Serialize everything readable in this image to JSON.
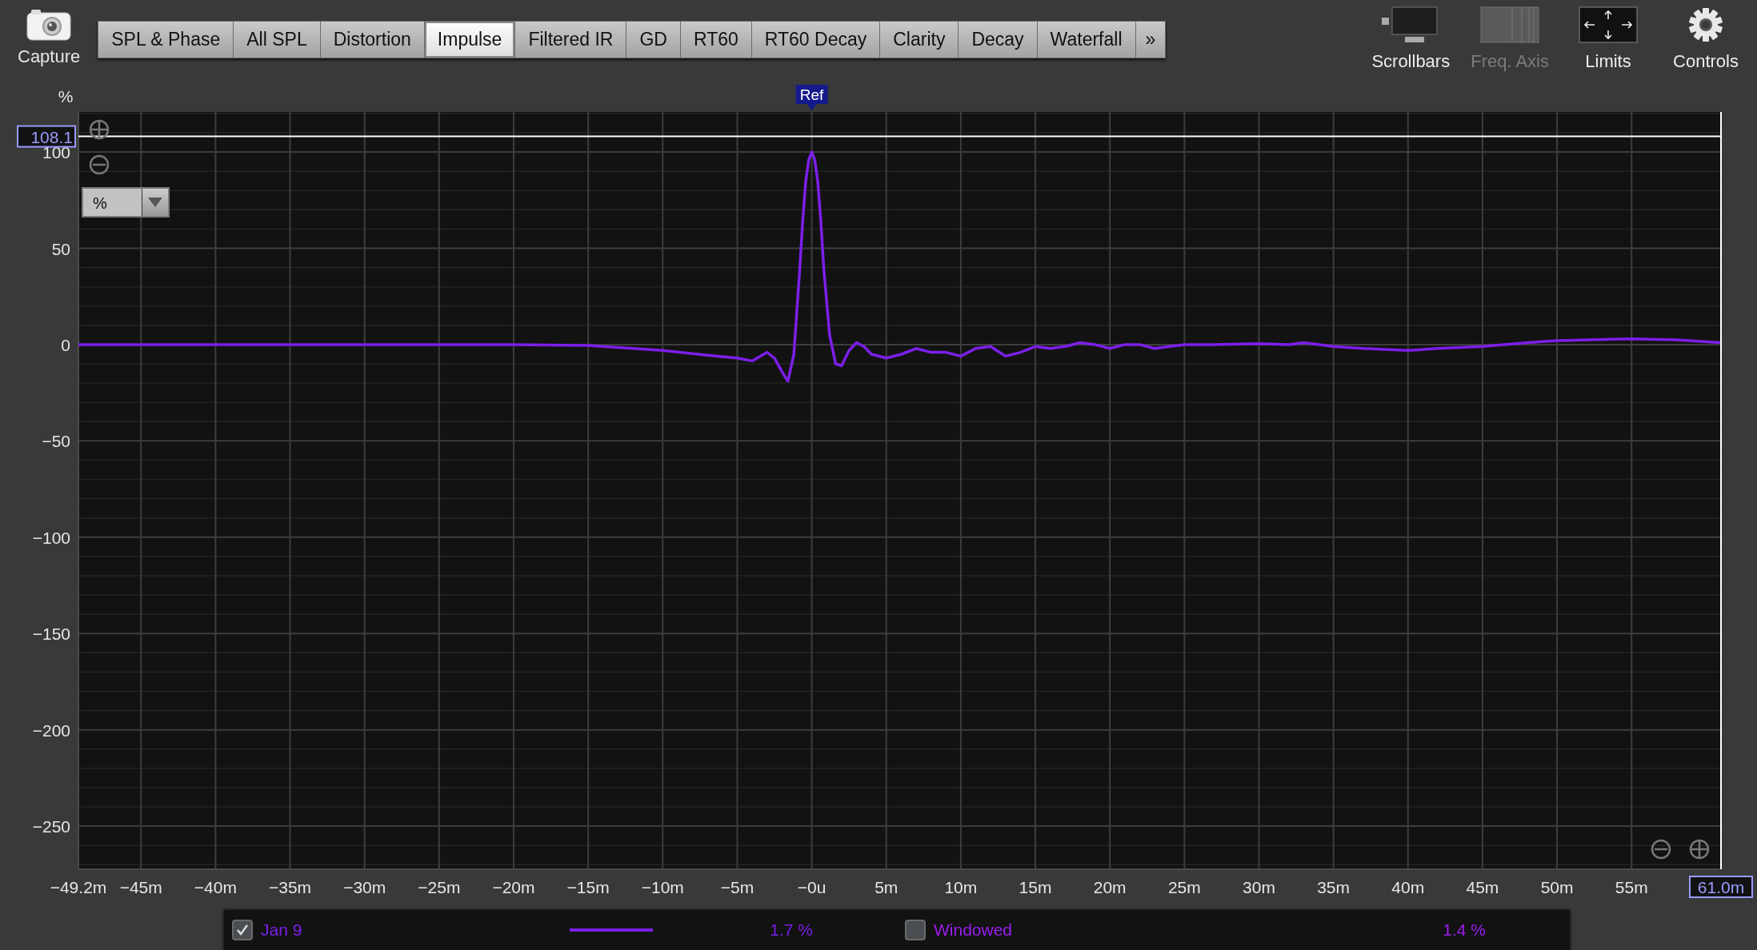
{
  "toolbar": {
    "capture": {
      "label": "Capture"
    },
    "tabs": [
      {
        "label": "SPL & Phase",
        "selected": false
      },
      {
        "label": "All SPL",
        "selected": false
      },
      {
        "label": "Distortion",
        "selected": false
      },
      {
        "label": "Impulse",
        "selected": true
      },
      {
        "label": "Filtered IR",
        "selected": false
      },
      {
        "label": "GD",
        "selected": false
      },
      {
        "label": "RT60",
        "selected": false
      },
      {
        "label": "RT60 Decay",
        "selected": false
      },
      {
        "label": "Clarity",
        "selected": false
      },
      {
        "label": "Decay",
        "selected": false
      },
      {
        "label": "Waterfall",
        "selected": false
      }
    ],
    "more": "»",
    "tools": [
      {
        "kind": "scrollbars",
        "label": "Scrollbars",
        "disabled": false
      },
      {
        "kind": "freq_axis",
        "label": "Freq. Axis",
        "disabled": true
      },
      {
        "kind": "limits",
        "label": "Limits",
        "disabled": false
      },
      {
        "kind": "controls",
        "label": "Controls",
        "disabled": false
      }
    ]
  },
  "graph": {
    "unit_label": "%",
    "ref_label": "Ref",
    "top_limit": "108.1",
    "right_limit": "61.0m",
    "unit_select": {
      "value": "%"
    },
    "chart_data": {
      "type": "line",
      "grid": true,
      "xlim": [
        -49.2,
        61.0
      ],
      "ylim": [
        -272.4,
        120.8
      ],
      "ref_lines": [
        {
          "axis": "y",
          "value": 108.1
        },
        {
          "axis": "x",
          "value": 61.0
        }
      ],
      "xticks": [
        {
          "value": -49.2,
          "label": "−49.2m"
        },
        {
          "value": -45,
          "label": "−45m"
        },
        {
          "value": -40,
          "label": "−40m"
        },
        {
          "value": -35,
          "label": "−35m"
        },
        {
          "value": -30,
          "label": "−30m"
        },
        {
          "value": -25,
          "label": "−25m"
        },
        {
          "value": -20,
          "label": "−20m"
        },
        {
          "value": -15,
          "label": "−15m"
        },
        {
          "value": -10,
          "label": "−10m"
        },
        {
          "value": -5,
          "label": "−5m"
        },
        {
          "value": 0,
          "label": "−0u"
        },
        {
          "value": 5,
          "label": "5m"
        },
        {
          "value": 10,
          "label": "10m"
        },
        {
          "value": 15,
          "label": "15m"
        },
        {
          "value": 20,
          "label": "20m"
        },
        {
          "value": 25,
          "label": "25m"
        },
        {
          "value": 30,
          "label": "30m"
        },
        {
          "value": 35,
          "label": "35m"
        },
        {
          "value": 40,
          "label": "40m"
        },
        {
          "value": 45,
          "label": "45m"
        },
        {
          "value": 50,
          "label": "50m"
        },
        {
          "value": 55,
          "label": "55m"
        }
      ],
      "yticks": [
        {
          "value": 100,
          "label": "100"
        },
        {
          "value": 50,
          "label": "50"
        },
        {
          "value": 0,
          "label": "0"
        },
        {
          "value": -50,
          "label": "−50"
        },
        {
          "value": -100,
          "label": "−100"
        },
        {
          "value": -150,
          "label": "−150"
        },
        {
          "value": -200,
          "label": "−200"
        },
        {
          "value": -250,
          "label": "−250"
        }
      ],
      "x": [
        -49.2,
        -20,
        -15,
        -10,
        -7,
        -5,
        -4,
        -3,
        -2.5,
        -2,
        -1.6,
        -1.2,
        -0.8,
        -0.6,
        -0.4,
        -0.2,
        0,
        0.2,
        0.4,
        0.6,
        0.8,
        1.2,
        1.6,
        2,
        2.5,
        3,
        3.5,
        4,
        5,
        6,
        7,
        8,
        9,
        10,
        11,
        12,
        13,
        14,
        15,
        16,
        17,
        18,
        19,
        20,
        21,
        22,
        23,
        24,
        25,
        27,
        30,
        32,
        33,
        35,
        37,
        40,
        42,
        45,
        48,
        50,
        55,
        58,
        61
      ],
      "series": [
        {
          "color": "#7b1fe8",
          "values": [
            0,
            0,
            -0.5,
            -3,
            -5.5,
            -7,
            -8.5,
            -4,
            -7,
            -14,
            -19,
            -5,
            40,
            65,
            85,
            96,
            100,
            96,
            85,
            65,
            40,
            5,
            -10,
            -11,
            -3,
            1,
            -1,
            -5,
            -7,
            -5,
            -2,
            -4,
            -4,
            -6,
            -2,
            -1,
            -6,
            -4,
            -1,
            -2,
            -1,
            1,
            0,
            -2,
            0,
            0,
            -2,
            -1,
            0,
            0,
            0.5,
            0,
            1,
            -1,
            -2,
            -3,
            -2,
            -1,
            1,
            2,
            3,
            2.5,
            1
          ]
        }
      ]
    }
  },
  "legend": [
    {
      "name": "Jan 9",
      "checked": true,
      "color": "#7b1fe8",
      "value": "1.7 %"
    },
    {
      "name": "Windowed",
      "checked": false,
      "color": "#9a1ff0",
      "value": "1.4 %"
    }
  ]
}
